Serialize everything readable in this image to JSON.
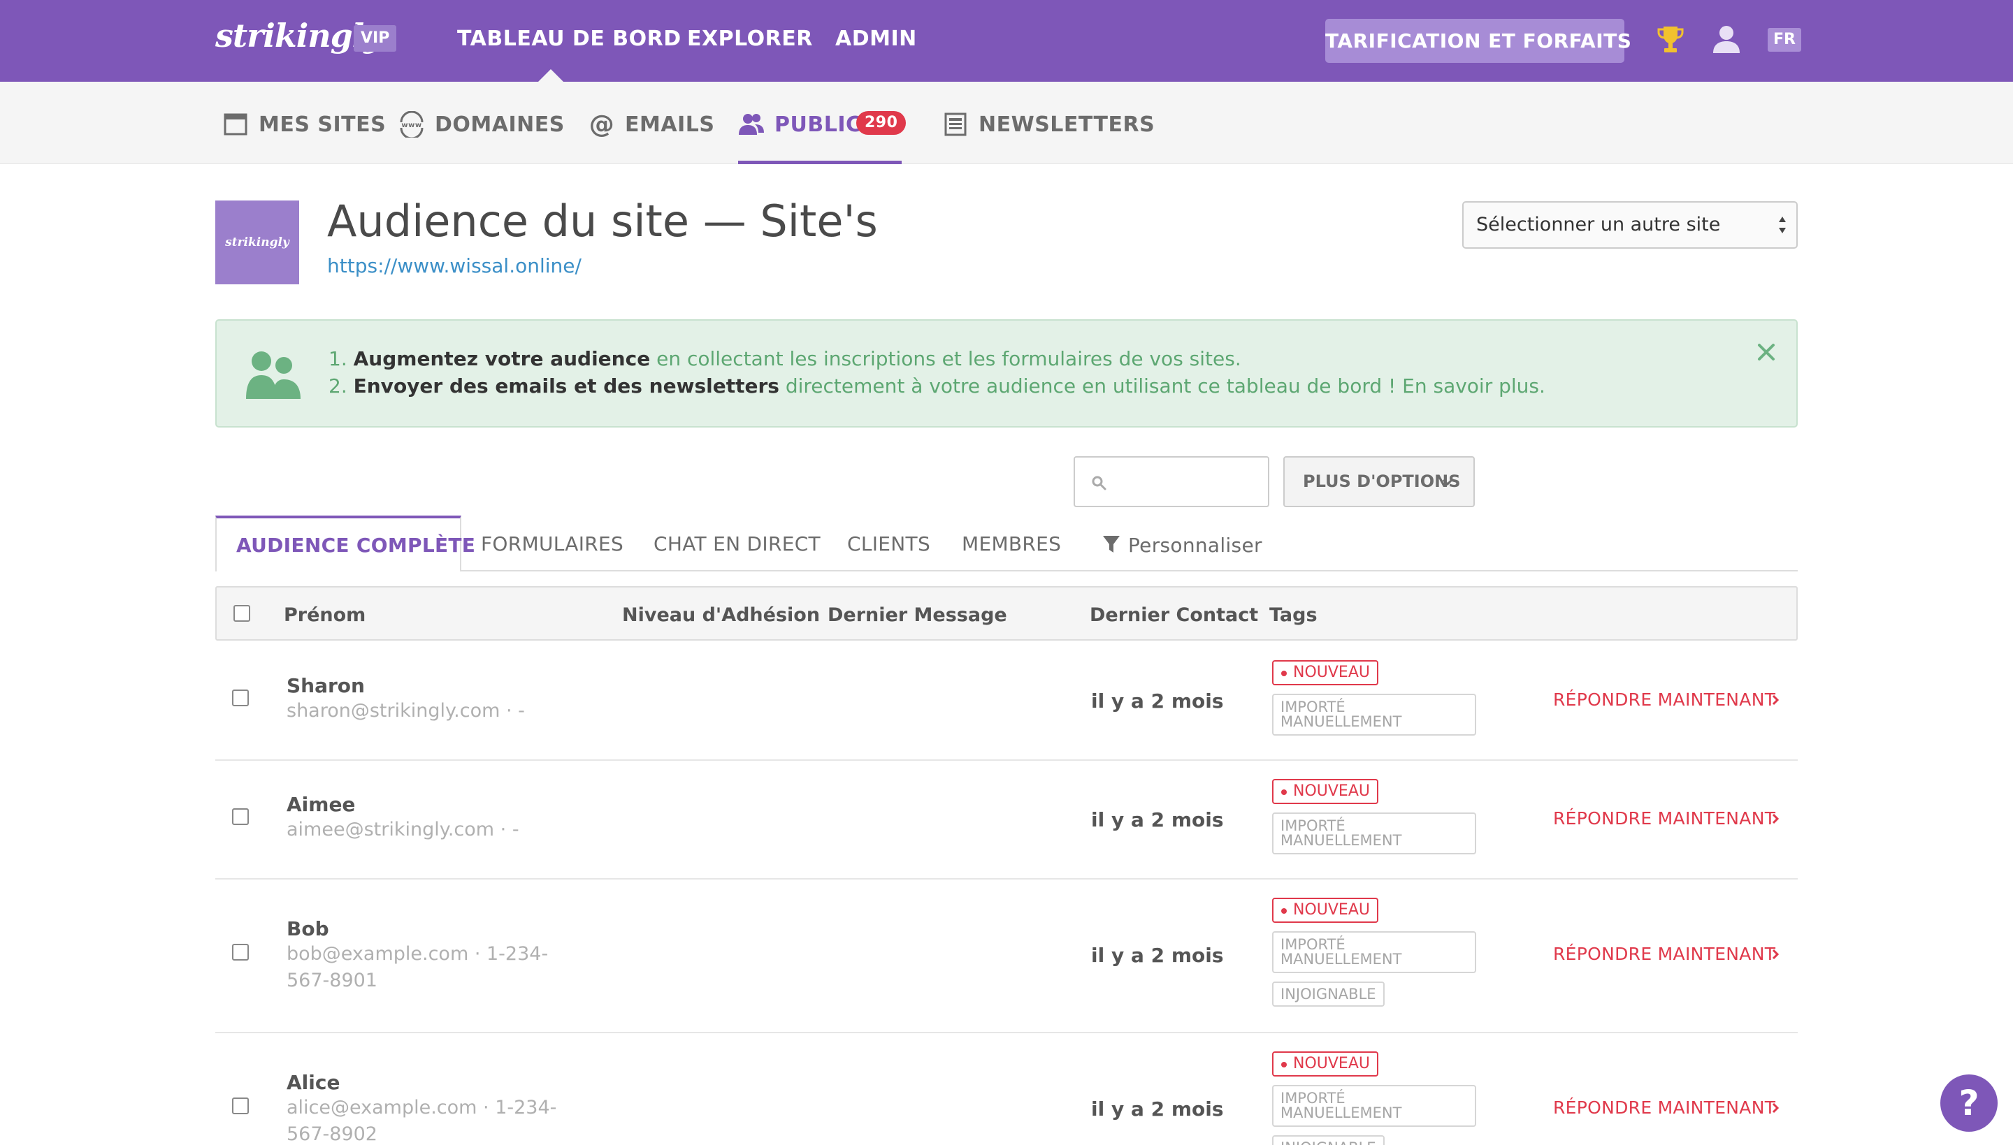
{
  "topnav": {
    "logo": "strikingly",
    "vip": "VIP",
    "items": [
      "TABLEAU DE BORD",
      "EXPLORER",
      "ADMIN"
    ],
    "pricing_button": "TARIFICATION ET FORFAITS",
    "language": "FR",
    "bg_color": "#7e57b8"
  },
  "subnav": {
    "items": [
      {
        "label": "MES SITES",
        "icon": "browser-window-icon"
      },
      {
        "label": "DOMAINES",
        "icon": "www-globe-icon"
      },
      {
        "label": "EMAILS",
        "icon": "at-sign-icon"
      },
      {
        "label": "PUBLIC",
        "icon": "users-icon",
        "badge": "290",
        "active": true
      },
      {
        "label": "NEWSLETTERS",
        "icon": "newspaper-icon"
      }
    ]
  },
  "header": {
    "thumb_text": "strikingly",
    "title": "Audience du site — Site's",
    "url": "https://www.wissal.online/",
    "site_select": "Sélectionner un autre site"
  },
  "alert": {
    "line1": {
      "num": "1. ",
      "bold": "Augmentez votre audience",
      "rest": " en collectant les inscriptions et les formulaires de vos sites."
    },
    "line2": {
      "num": "2. ",
      "bold": "Envoyer des emails et des newsletters",
      "rest": " directement à votre audience en utilisant ce tableau de bord ! En savoir plus."
    }
  },
  "controls": {
    "search_placeholder": "",
    "more_options": "PLUS D'OPTIONS"
  },
  "tabs": {
    "active": "AUDIENCE COMPLÈTE",
    "items": [
      "FORMULAIRES",
      "CHAT EN DIRECT",
      "CLIENTS",
      "MEMBRES"
    ],
    "customize": "Personnaliser"
  },
  "table": {
    "headers": {
      "first_name": "Prénom",
      "membership": "Niveau d'Adhésion",
      "last_message": "Dernier Message",
      "last_contact": "Dernier Contact",
      "tags": "Tags"
    },
    "reply_label": "RÉPONDRE MAINTENANT",
    "rows": [
      {
        "name": "Sharon",
        "contact": "sharon@strikingly.com · -",
        "last_contact": "il y a 2 mois",
        "tag_new": "NOUVEAU",
        "tag_import": "IMPORTÉ MANUELLEMENT"
      },
      {
        "name": "Aimee",
        "contact": "aimee@strikingly.com · -",
        "last_contact": "il y a 2 mois",
        "tag_new": "NOUVEAU",
        "tag_import": "IMPORTÉ MANUELLEMENT"
      },
      {
        "name": "Bob",
        "contact": "bob@example.com · 1-234-567-8901",
        "last_contact": "il y a 2 mois",
        "tag_new": "NOUVEAU",
        "tag_import": "IMPORTÉ MANUELLEMENT",
        "tag_extra": "INJOIGNABLE"
      },
      {
        "name": "Alice",
        "contact": "alice@example.com · 1-234-567-8902",
        "last_contact": "il y a 2 mois",
        "tag_new": "NOUVEAU",
        "tag_import": "IMPORTÉ MANUELLEMENT",
        "tag_extra": "INJOIGNABLE"
      }
    ]
  },
  "help": "?"
}
